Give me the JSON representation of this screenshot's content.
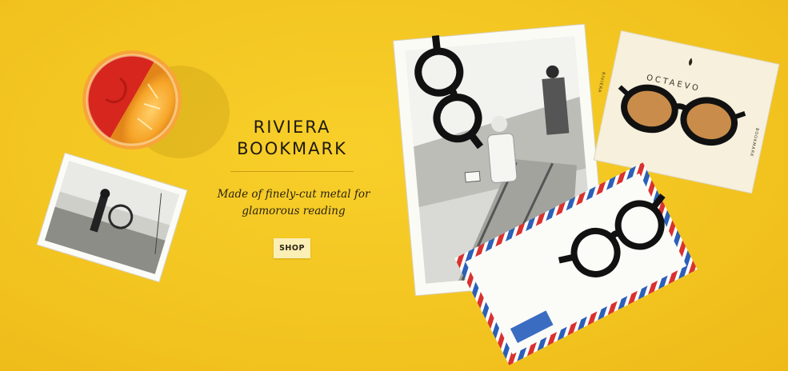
{
  "banner": {
    "title_line1": "RIVIERA",
    "title_line2": "BOOKMARK",
    "subtitle_line1": "Made of finely-cut metal for",
    "subtitle_line2": "glamorous reading",
    "shop_label": "SHOP"
  },
  "card": {
    "brand": "OCTAEVO",
    "side_left": "RIVIERA",
    "side_right": "BOOKMARK"
  },
  "colors": {
    "background": "#f3c521",
    "button": "#fbefb6",
    "text": "#1f1a10",
    "airmail_red": "#d8322f",
    "airmail_blue": "#2b5fb8"
  }
}
